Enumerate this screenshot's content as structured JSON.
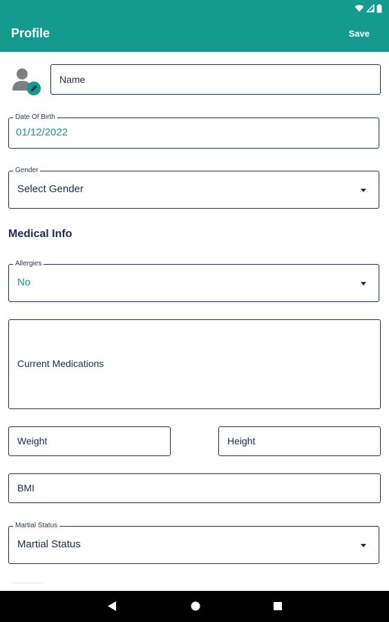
{
  "app": {
    "title": "Profile",
    "save_label": "Save",
    "accent_color": "#149a8f"
  },
  "status_bar": {
    "icons": [
      "wifi-icon",
      "signal-icon",
      "battery-icon"
    ]
  },
  "form": {
    "name": {
      "placeholder": "Name"
    },
    "date_of_birth": {
      "label": "Date Of Birth",
      "value": "01/12/2022"
    },
    "gender": {
      "label": "Gender",
      "value": "Select Gender"
    },
    "medical_section_title": "Medical Info",
    "allergies": {
      "label": "Allergies",
      "value": "No"
    },
    "current_medications": {
      "placeholder": "Current Medications"
    },
    "weight": {
      "placeholder": "Weight"
    },
    "height": {
      "placeholder": "Height"
    },
    "bmi": {
      "placeholder": "BMI"
    },
    "marital_status": {
      "label": "Martial Status",
      "value": "Martial Status"
    }
  },
  "nav_bar": {
    "buttons": [
      "back-icon",
      "home-icon",
      "recents-icon"
    ]
  }
}
